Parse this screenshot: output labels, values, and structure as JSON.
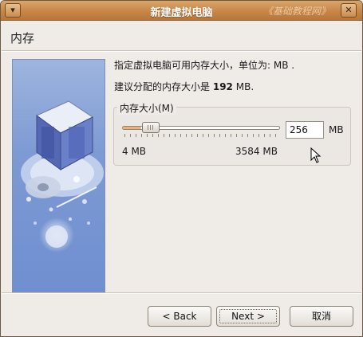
{
  "window": {
    "title": "新建虚拟电脑",
    "ghost_title": "《基础教程网》",
    "menu_glyph": "▾",
    "close_glyph": "✕"
  },
  "page": {
    "title": "内存",
    "description": "指定虚拟电脑可用内存大小，单位为: MB .",
    "recommend_prefix": "建议分配的内存大小是",
    "recommend_value": "192",
    "recommend_unit": "MB."
  },
  "memory": {
    "group_label": "内存大小(M)",
    "value": "256",
    "unit": "MB",
    "min_label": "4  MB",
    "max_label": "3584  MB",
    "min": 4,
    "max": 3584,
    "current": 256
  },
  "buttons": {
    "back": "< Back",
    "next": "Next >",
    "cancel": "取消"
  },
  "colors": {
    "titlebar": "#c9894a",
    "side_image": "#7e9ad3"
  }
}
